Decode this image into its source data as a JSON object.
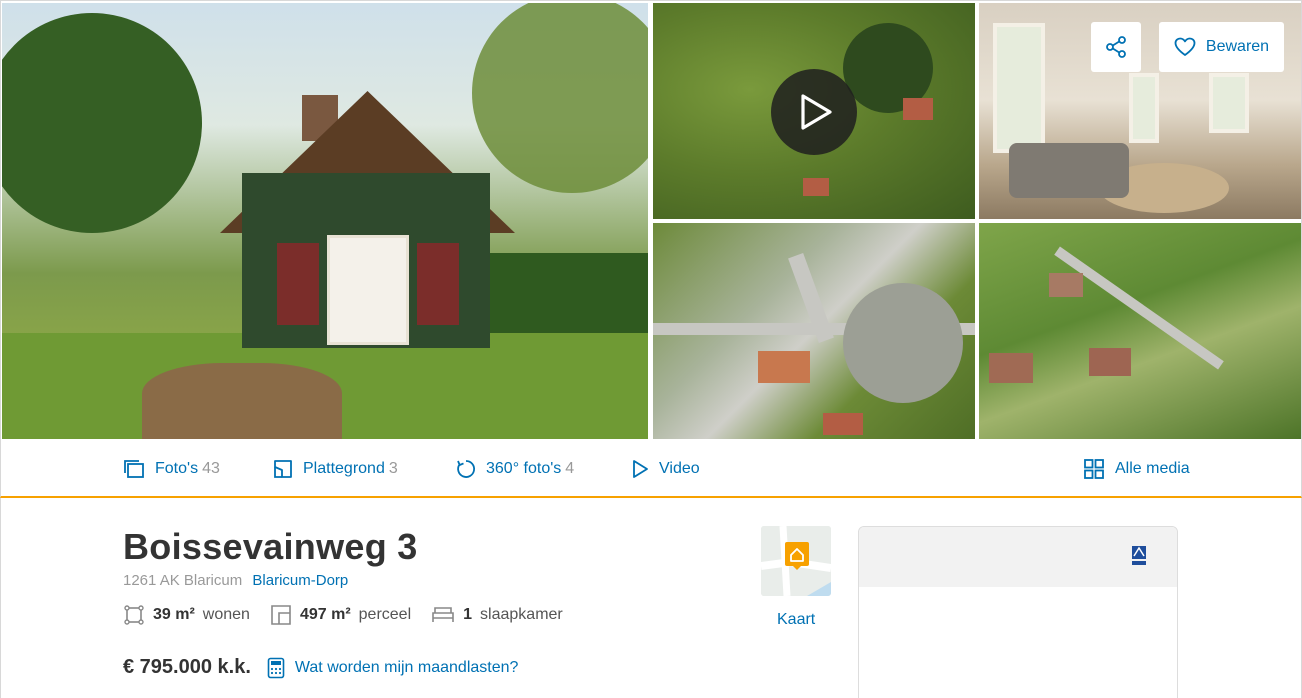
{
  "gallery": {
    "share_icon": "share-icon",
    "save_label": "Bewaren",
    "save_icon": "heart-icon",
    "play_icon": "play-icon"
  },
  "media_bar": {
    "fotos": {
      "label": "Foto's",
      "count": "43"
    },
    "plattegrond": {
      "label": "Plattegrond",
      "count": "3"
    },
    "foto360": {
      "label": "360° foto's",
      "count": "4"
    },
    "video": {
      "label": "Video"
    },
    "alle": {
      "label": "Alle media"
    }
  },
  "listing": {
    "title": "Boissevainweg 3",
    "postcode_city": "1261 AK Blaricum",
    "area": "Blaricum-Dorp",
    "features": {
      "wonen_value": "39 m²",
      "wonen_label": "wonen",
      "perceel_value": "497 m²",
      "perceel_label": "perceel",
      "slaapkamer_value": "1",
      "slaapkamer_label": "slaapkamer"
    },
    "price": "€ 795.000 k.k.",
    "calc_label": "Wat worden mijn maandlasten?"
  },
  "map": {
    "label": "Kaart"
  },
  "colors": {
    "accent": "#0071b3",
    "orange": "#f7a100",
    "text": "#333333",
    "muted": "#999999"
  }
}
